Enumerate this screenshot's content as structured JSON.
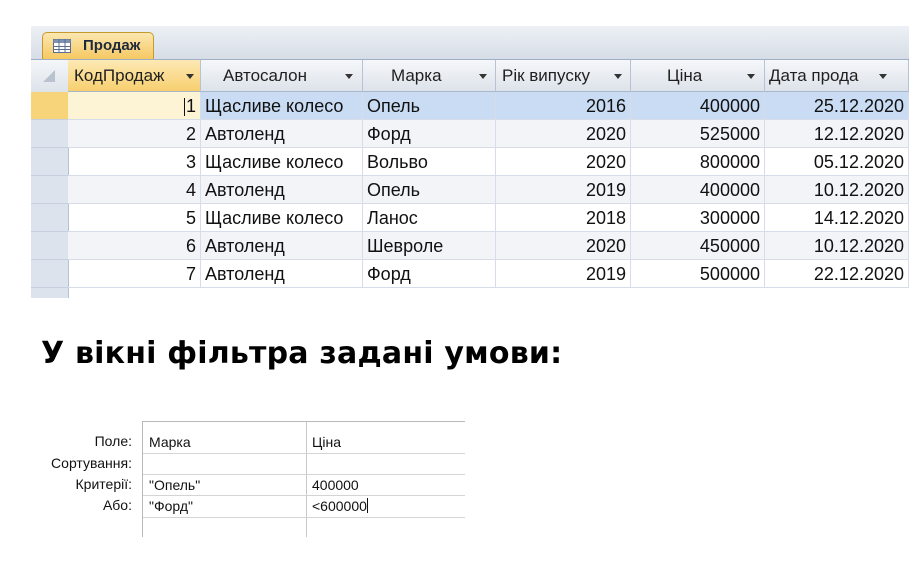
{
  "table_window": {
    "tab_label": "Продаж",
    "columns": [
      {
        "label": "КодПродаж",
        "key": "id"
      },
      {
        "label": "Автосалон",
        "key": "dealer"
      },
      {
        "label": "Марка",
        "key": "brand"
      },
      {
        "label": "Рік випуску",
        "key": "year"
      },
      {
        "label": "Ціна",
        "key": "price"
      },
      {
        "label": "Дата прода",
        "key": "date"
      }
    ],
    "rows": [
      {
        "id": "1",
        "dealer": "Щасливе колесо",
        "brand": "Опель",
        "year": "2016",
        "price": "400000",
        "date": "25.12.2020"
      },
      {
        "id": "2",
        "dealer": "Автоленд",
        "brand": "Форд",
        "year": "2020",
        "price": "525000",
        "date": "12.12.2020"
      },
      {
        "id": "3",
        "dealer": "Щасливе колесо",
        "brand": "Вольво",
        "year": "2020",
        "price": "800000",
        "date": "05.12.2020"
      },
      {
        "id": "4",
        "dealer": "Автоленд",
        "brand": "Опель",
        "year": "2019",
        "price": "400000",
        "date": "10.12.2020"
      },
      {
        "id": "5",
        "dealer": "Щасливе колесо",
        "brand": "Ланос",
        "year": "2018",
        "price": "300000",
        "date": "14.12.2020"
      },
      {
        "id": "6",
        "dealer": "Автоленд",
        "brand": "Шевроле",
        "year": "2020",
        "price": "450000",
        "date": "10.12.2020"
      },
      {
        "id": "7",
        "dealer": "Автоленд",
        "brand": "Форд",
        "year": "2019",
        "price": "500000",
        "date": "22.12.2020"
      }
    ]
  },
  "heading": "У вікні фільтра задані умови:",
  "filter": {
    "row_labels": {
      "field": "Поле:",
      "sort": "Сортування:",
      "criteria": "Критерії:",
      "or": "Або:"
    },
    "columns": [
      {
        "field": "Марка",
        "sort": "",
        "criteria": "\"Опель\"",
        "or": "\"Форд\""
      },
      {
        "field": "Ціна",
        "sort": "",
        "criteria": "400000",
        "or": "<600000"
      }
    ]
  },
  "colors": {
    "tab_accent": "#f6c862",
    "selected_row": "#c9dcf4",
    "header_active": "#f7cf6f"
  }
}
